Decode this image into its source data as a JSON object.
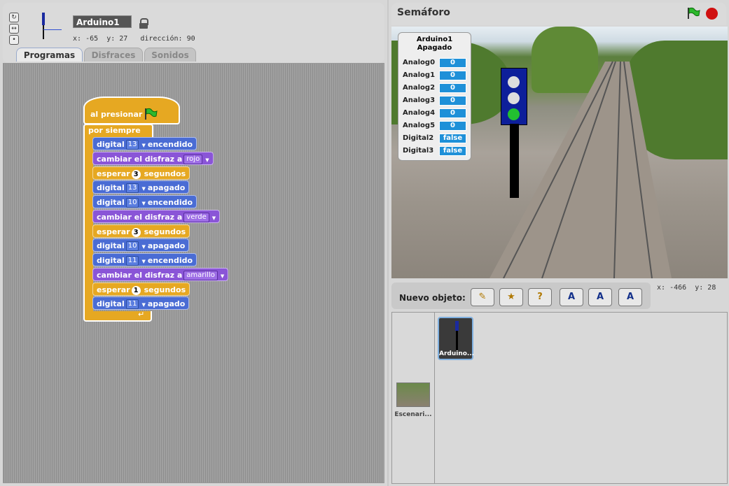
{
  "sprite": {
    "name": "Arduino1",
    "x_label": "x:",
    "x": "-65",
    "y_label": "y:",
    "y": "27",
    "dir_label": "dirección:",
    "dir": "90"
  },
  "tabs": [
    "Programas",
    "Disfraces",
    "Sonidos"
  ],
  "script": {
    "hat": "al presionar",
    "forever": "por siempre",
    "blocks": [
      {
        "a": "digital",
        "v": "13",
        "b": "encendido"
      },
      {
        "a": "cambiar el disfraz a",
        "v": "rojo"
      },
      {
        "a": "esperar",
        "v": "3",
        "b": "segundos"
      },
      {
        "a": "digital",
        "v": "13",
        "b": "apagado"
      },
      {
        "a": "digital",
        "v": "10",
        "b": "encendido"
      },
      {
        "a": "cambiar el disfraz a",
        "v": "verde"
      },
      {
        "a": "esperar",
        "v": "3",
        "b": "segundos"
      },
      {
        "a": "digital",
        "v": "10",
        "b": "apagado"
      },
      {
        "a": "digital",
        "v": "11",
        "b": "encendido"
      },
      {
        "a": "cambiar el disfraz a",
        "v": "amarillo"
      },
      {
        "a": "esperar",
        "v": "1",
        "b": "segundos"
      },
      {
        "a": "digital",
        "v": "11",
        "b": "apagado"
      }
    ]
  },
  "stage": {
    "title": "Semáforo",
    "mouse_x_label": "x:",
    "mouse_x": "-466",
    "mouse_y_label": "y:",
    "mouse_y": "28"
  },
  "monitor": {
    "title1": "Arduino1",
    "title2": "Apagado",
    "rows": [
      {
        "label": "Analog0",
        "value": "0"
      },
      {
        "label": "Analog1",
        "value": "0"
      },
      {
        "label": "Analog2",
        "value": "0"
      },
      {
        "label": "Analog3",
        "value": "0"
      },
      {
        "label": "Analog4",
        "value": "0"
      },
      {
        "label": "Analog5",
        "value": "0"
      },
      {
        "label": "Digital2",
        "value": "false"
      },
      {
        "label": "Digital3",
        "value": "false"
      }
    ]
  },
  "new_object_label": "Nuevo objeto:",
  "sprites_list": [
    {
      "name": "Arduino..."
    },
    {
      "name": "Escenari..."
    }
  ],
  "colors": {
    "green_flag": "#2db82d",
    "stop": "#d01010",
    "motion": "#4a6cd4",
    "looks": "#8a55d7",
    "control": "#e6a822"
  }
}
